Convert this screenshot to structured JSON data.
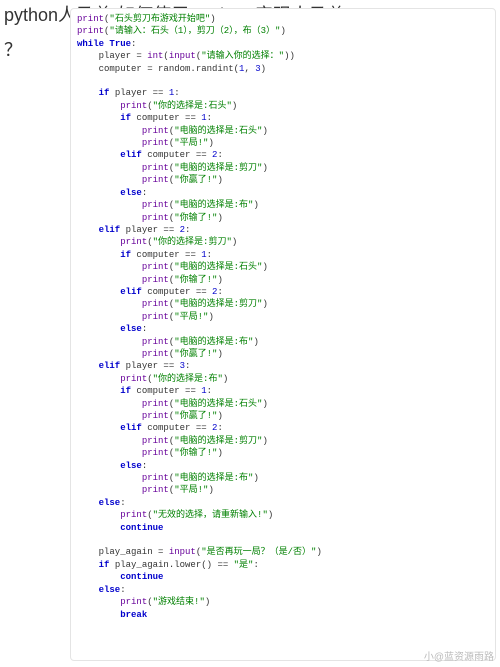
{
  "title": "python人马兽,如何使用 Python 实现人马兽",
  "qmark": "？",
  "watermark": "小@蓝资源雨路",
  "code": {
    "lines": [
      {
        "indent": 0,
        "html": "<span class='builtin'>print</span>(<span class='str'>\"石头剪刀布游戏开始吧\"</span>)"
      },
      {
        "indent": 0,
        "html": "<span class='builtin'>print</span>(<span class='str'>\"请输入：石头（1），剪刀（2），布（3）\"</span>)"
      },
      {
        "indent": 0,
        "html": ""
      },
      {
        "indent": 0,
        "html": "<span class='kw'>while</span> <span class='kw'>True</span>:"
      },
      {
        "indent": 1,
        "html": "player = <span class='builtin'>int</span>(<span class='builtin'>input</span>(<span class='str'>\"请输入你的选择：\"</span>))"
      },
      {
        "indent": 1,
        "html": "computer = random.randint(<span class='num'>1</span>, <span class='num'>3</span>)"
      },
      {
        "indent": 1,
        "html": ""
      },
      {
        "indent": 1,
        "html": "<span class='kw'>if</span> player == <span class='num'>1</span>:"
      },
      {
        "indent": 2,
        "html": "<span class='builtin'>print</span>(<span class='str'>\"你的选择是:石头\"</span>)"
      },
      {
        "indent": 2,
        "html": "<span class='kw'>if</span> computer == <span class='num'>1</span>:"
      },
      {
        "indent": 3,
        "html": "<span class='builtin'>print</span>(<span class='str'>\"电脑的选择是:石头\"</span>)"
      },
      {
        "indent": 3,
        "html": "<span class='builtin'>print</span>(<span class='str'>\"平局!\"</span>)"
      },
      {
        "indent": 2,
        "html": "<span class='kw'>elif</span> computer == <span class='num'>2</span>:"
      },
      {
        "indent": 3,
        "html": "<span class='builtin'>print</span>(<span class='str'>\"电脑的选择是:剪刀\"</span>)"
      },
      {
        "indent": 3,
        "html": "<span class='builtin'>print</span>(<span class='str'>\"你赢了!\"</span>)"
      },
      {
        "indent": 2,
        "html": "<span class='kw'>else</span>:"
      },
      {
        "indent": 3,
        "html": "<span class='builtin'>print</span>(<span class='str'>\"电脑的选择是:布\"</span>)"
      },
      {
        "indent": 3,
        "html": "<span class='builtin'>print</span>(<span class='str'>\"你输了!\"</span>)"
      },
      {
        "indent": 1,
        "html": "<span class='kw'>elif</span> player == <span class='num'>2</span>:"
      },
      {
        "indent": 2,
        "html": "<span class='builtin'>print</span>(<span class='str'>\"你的选择是:剪刀\"</span>)"
      },
      {
        "indent": 2,
        "html": "<span class='kw'>if</span> computer == <span class='num'>1</span>:"
      },
      {
        "indent": 3,
        "html": "<span class='builtin'>print</span>(<span class='str'>\"电脑的选择是:石头\"</span>)"
      },
      {
        "indent": 3,
        "html": "<span class='builtin'>print</span>(<span class='str'>\"你输了!\"</span>)"
      },
      {
        "indent": 2,
        "html": "<span class='kw'>elif</span> computer == <span class='num'>2</span>:"
      },
      {
        "indent": 3,
        "html": "<span class='builtin'>print</span>(<span class='str'>\"电脑的选择是:剪刀\"</span>)"
      },
      {
        "indent": 3,
        "html": "<span class='builtin'>print</span>(<span class='str'>\"平局!\"</span>)"
      },
      {
        "indent": 2,
        "html": "<span class='kw'>else</span>:"
      },
      {
        "indent": 3,
        "html": "<span class='builtin'>print</span>(<span class='str'>\"电脑的选择是:布\"</span>)"
      },
      {
        "indent": 3,
        "html": "<span class='builtin'>print</span>(<span class='str'>\"你赢了!\"</span>)"
      },
      {
        "indent": 1,
        "html": "<span class='kw'>elif</span> player == <span class='num'>3</span>:"
      },
      {
        "indent": 2,
        "html": "<span class='builtin'>print</span>(<span class='str'>\"你的选择是:布\"</span>)"
      },
      {
        "indent": 2,
        "html": "<span class='kw'>if</span> computer == <span class='num'>1</span>:"
      },
      {
        "indent": 3,
        "html": "<span class='builtin'>print</span>(<span class='str'>\"电脑的选择是:石头\"</span>)"
      },
      {
        "indent": 3,
        "html": "<span class='builtin'>print</span>(<span class='str'>\"你赢了!\"</span>)"
      },
      {
        "indent": 2,
        "html": "<span class='kw'>elif</span> computer == <span class='num'>2</span>:"
      },
      {
        "indent": 3,
        "html": "<span class='builtin'>print</span>(<span class='str'>\"电脑的选择是:剪刀\"</span>)"
      },
      {
        "indent": 3,
        "html": "<span class='builtin'>print</span>(<span class='str'>\"你输了!\"</span>)"
      },
      {
        "indent": 2,
        "html": "<span class='kw'>else</span>:"
      },
      {
        "indent": 3,
        "html": "<span class='builtin'>print</span>(<span class='str'>\"电脑的选择是:布\"</span>)"
      },
      {
        "indent": 3,
        "html": "<span class='builtin'>print</span>(<span class='str'>\"平局!\"</span>)"
      },
      {
        "indent": 1,
        "html": "<span class='kw'>else</span>:"
      },
      {
        "indent": 2,
        "html": "<span class='builtin'>print</span>(<span class='str'>\"无效的选择，请重新输入!\"</span>)"
      },
      {
        "indent": 2,
        "html": "<span class='kw'>continue</span>"
      },
      {
        "indent": 1,
        "html": ""
      },
      {
        "indent": 1,
        "html": "play_again = <span class='builtin'>input</span>(<span class='str'>\"是否再玩一局？（是/否）\"</span>)"
      },
      {
        "indent": 1,
        "html": "<span class='kw'>if</span> play_again.lower() == <span class='str'>\"是\"</span>:"
      },
      {
        "indent": 2,
        "html": "<span class='kw'>continue</span>"
      },
      {
        "indent": 1,
        "html": "<span class='kw'>else</span>:"
      },
      {
        "indent": 2,
        "html": "<span class='builtin'>print</span>(<span class='str'>\"游戏结束!\"</span>)"
      },
      {
        "indent": 2,
        "html": "<span class='kw'>break</span>"
      }
    ]
  }
}
